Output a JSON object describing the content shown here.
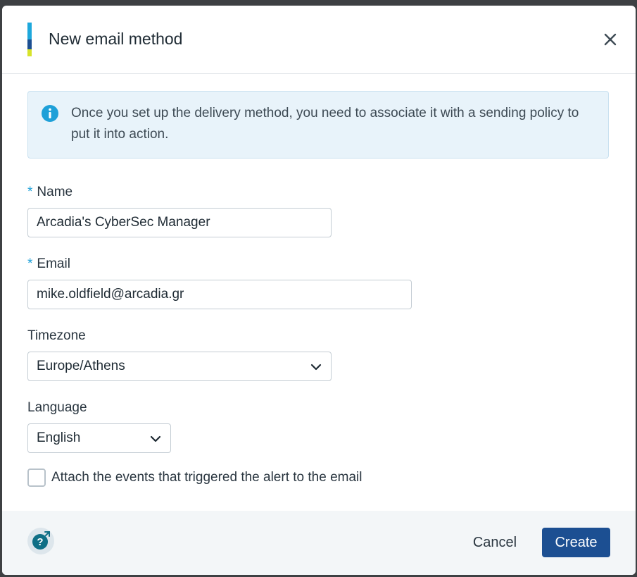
{
  "dialog": {
    "title": "New email method",
    "close_icon": "close-icon",
    "accent_colors": [
      "#1ea8dc",
      "#1c4f92",
      "#d7e32b"
    ]
  },
  "info": {
    "icon": "info-icon",
    "text": "Once you set up the delivery method, you need to associate it with a sending policy to put it into action."
  },
  "form": {
    "name": {
      "label": "Name",
      "required_marker": "*",
      "value": "Arcadia's CyberSec Manager"
    },
    "email": {
      "label": "Email",
      "required_marker": "*",
      "value": "mike.oldfield@arcadia.gr"
    },
    "timezone": {
      "label": "Timezone",
      "value": "Europe/Athens",
      "icon": "chevron-down-icon"
    },
    "language": {
      "label": "Language",
      "value": "English",
      "icon": "chevron-down-icon"
    },
    "attach_events": {
      "label": "Attach the events that triggered the alert to the email",
      "checked": false
    }
  },
  "footer": {
    "help_icon": "help-icon",
    "cancel_label": "Cancel",
    "create_label": "Create",
    "primary_color": "#1c4f92"
  }
}
